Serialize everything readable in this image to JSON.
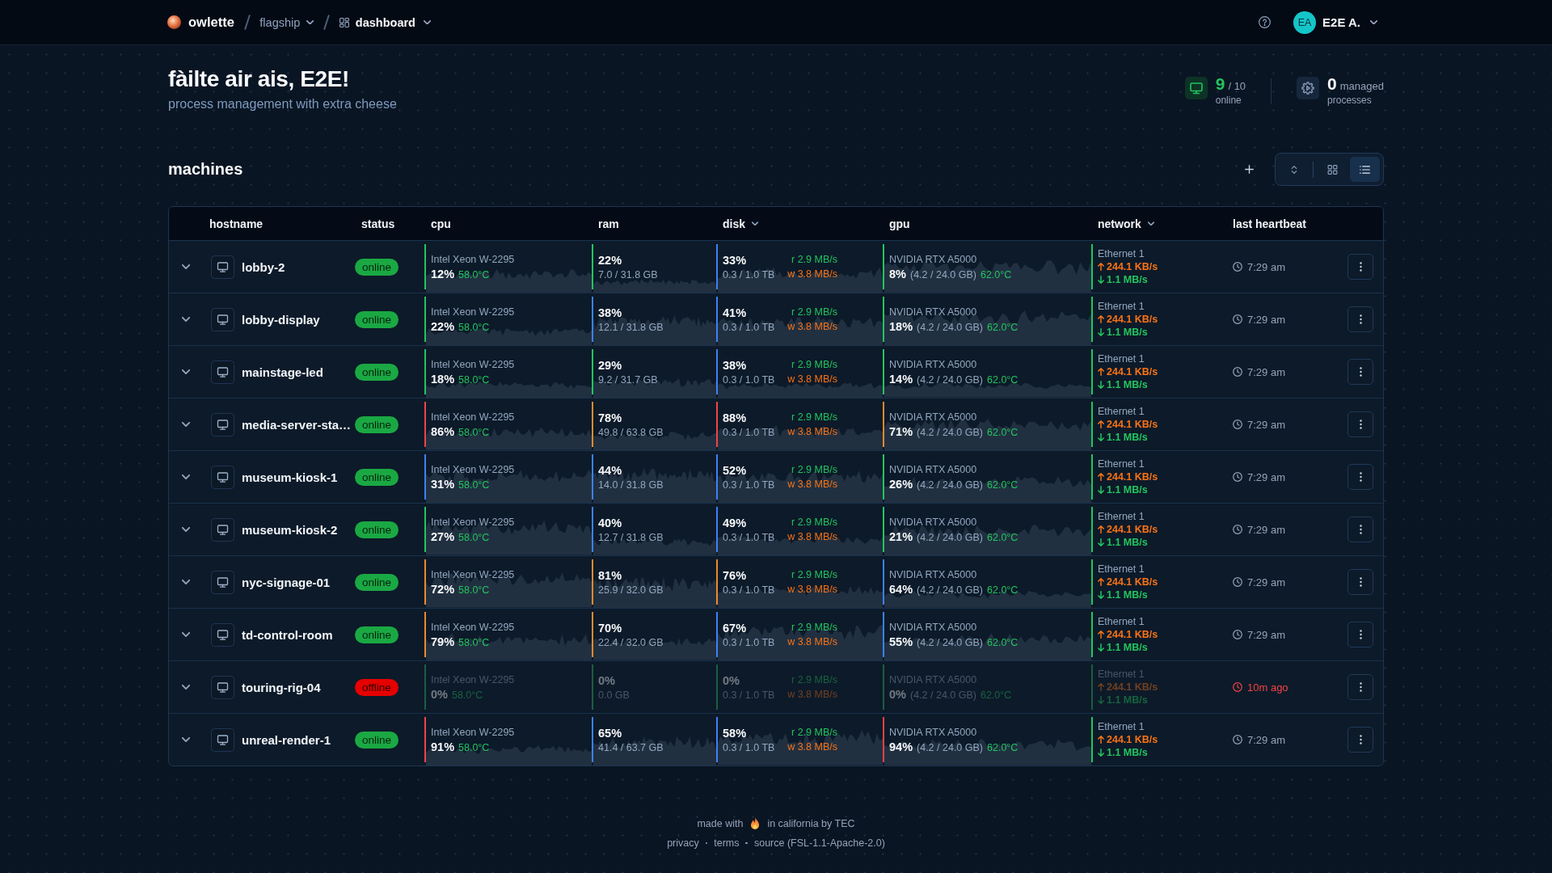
{
  "header": {
    "brand": "owlette",
    "breadcrumbs": [
      {
        "label": "flagship",
        "kind": "workspace"
      },
      {
        "label": "dashboard",
        "kind": "page"
      }
    ],
    "user": {
      "initials": "EA",
      "name": "E2E A."
    }
  },
  "greeting": {
    "title": "fàilte air ais, E2E!",
    "subtitle": "process management with extra cheese"
  },
  "stats": [
    {
      "kind": "machines",
      "value": "9",
      "detail": "/ 10",
      "label": "online"
    },
    {
      "kind": "processes",
      "value": "0",
      "detail": "managed",
      "label": "processes"
    }
  ],
  "machines": {
    "title": "machines",
    "view_options": [
      {
        "kind": "grid",
        "selected": false
      },
      {
        "kind": "list",
        "selected": true
      }
    ]
  },
  "table": {
    "columns": [
      {
        "label": "hostname",
        "sortable": false
      },
      {
        "label": "status",
        "sortable": false
      },
      {
        "label": "cpu",
        "sortable": false
      },
      {
        "label": "ram",
        "sortable": false
      },
      {
        "label": "disk",
        "sortable": true
      },
      {
        "label": "gpu",
        "sortable": false
      },
      {
        "label": "network",
        "sortable": true
      },
      {
        "label": "last heartbeat",
        "sortable": false
      }
    ],
    "rows": [
      {
        "hostname": "lobby-2",
        "status": "online",
        "online": true,
        "cpu": {
          "model": "Intel Xeon W-2295",
          "usage": "12%",
          "temp": "58.0°C",
          "color": "#22c55e"
        },
        "ram": {
          "usage": "22%",
          "detail": "7.0 / 31.8 GB",
          "color": "#22c55e"
        },
        "disk": {
          "usage": "33%",
          "detail": "0.3 / 1.0 TB",
          "read": "r 2.9 MB/s",
          "write": "w 3.8 MB/s",
          "color": "#3b82f6"
        },
        "gpu": {
          "model": "NVIDIA RTX A5000",
          "usage": "8%",
          "memory": "(4.2 / 24.0 GB)",
          "temp": "62.0°C",
          "color": "#22c55e"
        },
        "network": {
          "interface": "Ethernet 1",
          "upload": "244.1 KB/s",
          "download": "1.1 MB/s",
          "color": "#22c55e"
        },
        "last_heartbeat": "7:29 am"
      },
      {
        "hostname": "lobby-display",
        "status": "online",
        "online": true,
        "cpu": {
          "model": "Intel Xeon W-2295",
          "usage": "22%",
          "temp": "58.0°C",
          "color": "#22c55e"
        },
        "ram": {
          "usage": "38%",
          "detail": "12.1 / 31.8 GB",
          "color": "#3b82f6"
        },
        "disk": {
          "usage": "41%",
          "detail": "0.3 / 1.0 TB",
          "read": "r 2.9 MB/s",
          "write": "w 3.8 MB/s",
          "color": "#3b82f6"
        },
        "gpu": {
          "model": "NVIDIA RTX A5000",
          "usage": "18%",
          "memory": "(4.2 / 24.0 GB)",
          "temp": "62.0°C",
          "color": "#22c55e"
        },
        "network": {
          "interface": "Ethernet 1",
          "upload": "244.1 KB/s",
          "download": "1.1 MB/s",
          "color": "#22c55e"
        },
        "last_heartbeat": "7:29 am"
      },
      {
        "hostname": "mainstage-led",
        "status": "online",
        "online": true,
        "cpu": {
          "model": "Intel Xeon W-2295",
          "usage": "18%",
          "temp": "58.0°C",
          "color": "#22c55e"
        },
        "ram": {
          "usage": "29%",
          "detail": "9.2 / 31.7 GB",
          "color": "#22c55e"
        },
        "disk": {
          "usage": "38%",
          "detail": "0.3 / 1.0 TB",
          "read": "r 2.9 MB/s",
          "write": "w 3.8 MB/s",
          "color": "#3b82f6"
        },
        "gpu": {
          "model": "NVIDIA RTX A5000",
          "usage": "14%",
          "memory": "(4.2 / 24.0 GB)",
          "temp": "62.0°C",
          "color": "#22c55e"
        },
        "network": {
          "interface": "Ethernet 1",
          "upload": "244.1 KB/s",
          "download": "1.1 MB/s",
          "color": "#22c55e"
        },
        "last_heartbeat": "7:29 am"
      },
      {
        "hostname": "media-server-sta…",
        "status": "online",
        "online": true,
        "cpu": {
          "model": "Intel Xeon W-2295",
          "usage": "86%",
          "temp": "58.0°C",
          "color": "#ef4444"
        },
        "ram": {
          "usage": "78%",
          "detail": "49.8 / 63.8 GB",
          "color": "#ea8a2e"
        },
        "disk": {
          "usage": "88%",
          "detail": "0.3 / 1.0 TB",
          "read": "r 2.9 MB/s",
          "write": "w 3.8 MB/s",
          "color": "#ef4444"
        },
        "gpu": {
          "model": "NVIDIA RTX A5000",
          "usage": "71%",
          "memory": "(4.2 / 24.0 GB)",
          "temp": "62.0°C",
          "color": "#ea8a2e"
        },
        "network": {
          "interface": "Ethernet 1",
          "upload": "244.1 KB/s",
          "download": "1.1 MB/s",
          "color": "#22c55e"
        },
        "last_heartbeat": "7:29 am"
      },
      {
        "hostname": "museum-kiosk-1",
        "status": "online",
        "online": true,
        "cpu": {
          "model": "Intel Xeon W-2295",
          "usage": "31%",
          "temp": "58.0°C",
          "color": "#3b82f6"
        },
        "ram": {
          "usage": "44%",
          "detail": "14.0 / 31.8 GB",
          "color": "#3b82f6"
        },
        "disk": {
          "usage": "52%",
          "detail": "0.3 / 1.0 TB",
          "read": "r 2.9 MB/s",
          "write": "w 3.8 MB/s",
          "color": "#3b82f6"
        },
        "gpu": {
          "model": "NVIDIA RTX A5000",
          "usage": "26%",
          "memory": "(4.2 / 24.0 GB)",
          "temp": "62.0°C",
          "color": "#22c55e"
        },
        "network": {
          "interface": "Ethernet 1",
          "upload": "244.1 KB/s",
          "download": "1.1 MB/s",
          "color": "#22c55e"
        },
        "last_heartbeat": "7:29 am"
      },
      {
        "hostname": "museum-kiosk-2",
        "status": "online",
        "online": true,
        "cpu": {
          "model": "Intel Xeon W-2295",
          "usage": "27%",
          "temp": "58.0°C",
          "color": "#22c55e"
        },
        "ram": {
          "usage": "40%",
          "detail": "12.7 / 31.8 GB",
          "color": "#3b82f6"
        },
        "disk": {
          "usage": "49%",
          "detail": "0.3 / 1.0 TB",
          "read": "r 2.9 MB/s",
          "write": "w 3.8 MB/s",
          "color": "#3b82f6"
        },
        "gpu": {
          "model": "NVIDIA RTX A5000",
          "usage": "21%",
          "memory": "(4.2 / 24.0 GB)",
          "temp": "62.0°C",
          "color": "#22c55e"
        },
        "network": {
          "interface": "Ethernet 1",
          "upload": "244.1 KB/s",
          "download": "1.1 MB/s",
          "color": "#22c55e"
        },
        "last_heartbeat": "7:29 am"
      },
      {
        "hostname": "nyc-signage-01",
        "status": "online",
        "online": true,
        "cpu": {
          "model": "Intel Xeon W-2295",
          "usage": "72%",
          "temp": "58.0°C",
          "color": "#ea8a2e"
        },
        "ram": {
          "usage": "81%",
          "detail": "25.9 / 32.0 GB",
          "color": "#ea8a2e"
        },
        "disk": {
          "usage": "76%",
          "detail": "0.3 / 1.0 TB",
          "read": "r 2.9 MB/s",
          "write": "w 3.8 MB/s",
          "color": "#ea8a2e"
        },
        "gpu": {
          "model": "NVIDIA RTX A5000",
          "usage": "64%",
          "memory": "(4.2 / 24.0 GB)",
          "temp": "62.0°C",
          "color": "#3b82f6"
        },
        "network": {
          "interface": "Ethernet 1",
          "upload": "244.1 KB/s",
          "download": "1.1 MB/s",
          "color": "#22c55e"
        },
        "last_heartbeat": "7:29 am"
      },
      {
        "hostname": "td-control-room",
        "status": "online",
        "online": true,
        "cpu": {
          "model": "Intel Xeon W-2295",
          "usage": "79%",
          "temp": "58.0°C",
          "color": "#ea8a2e"
        },
        "ram": {
          "usage": "70%",
          "detail": "22.4 / 32.0 GB",
          "color": "#ea8a2e"
        },
        "disk": {
          "usage": "67%",
          "detail": "0.3 / 1.0 TB",
          "read": "r 2.9 MB/s",
          "write": "w 3.8 MB/s",
          "color": "#3b82f6"
        },
        "gpu": {
          "model": "NVIDIA RTX A5000",
          "usage": "55%",
          "memory": "(4.2 / 24.0 GB)",
          "temp": "62.0°C",
          "color": "#3b82f6"
        },
        "network": {
          "interface": "Ethernet 1",
          "upload": "244.1 KB/s",
          "download": "1.1 MB/s",
          "color": "#22c55e"
        },
        "last_heartbeat": "7:29 am"
      },
      {
        "hostname": "touring-rig-04",
        "status": "offline",
        "online": false,
        "cpu": {
          "model": "Intel Xeon W-2295",
          "usage": "0%",
          "temp": "58.0°C",
          "color": "#1b5e3f"
        },
        "ram": {
          "usage": "0%",
          "detail": "0.0 GB",
          "color": "#1b5e3f"
        },
        "disk": {
          "usage": "0%",
          "detail": "0.3 / 1.0 TB",
          "read": "r 2.9 MB/s",
          "write": "w 3.8 MB/s",
          "color": "#1b5e3f"
        },
        "gpu": {
          "model": "NVIDIA RTX A5000",
          "usage": "0%",
          "memory": "(4.2 / 24.0 GB)",
          "temp": "62.0°C",
          "color": "#1b5e3f"
        },
        "network": {
          "interface": "Ethernet 1",
          "upload": "244.1 KB/s",
          "download": "1.1 MB/s",
          "color": "#1b5e3f"
        },
        "last_heartbeat": "10m ago"
      },
      {
        "hostname": "unreal-render-1",
        "status": "online",
        "online": true,
        "cpu": {
          "model": "Intel Xeon W-2295",
          "usage": "91%",
          "temp": "58.0°C",
          "color": "#ef4444"
        },
        "ram": {
          "usage": "65%",
          "detail": "41.4 / 63.7 GB",
          "color": "#3b82f6"
        },
        "disk": {
          "usage": "58%",
          "detail": "0.3 / 1.0 TB",
          "read": "r 2.9 MB/s",
          "write": "w 3.8 MB/s",
          "color": "#3b82f6"
        },
        "gpu": {
          "model": "NVIDIA RTX A5000",
          "usage": "94%",
          "memory": "(4.2 / 24.0 GB)",
          "temp": "62.0°C",
          "color": "#ef4444"
        },
        "network": {
          "interface": "Ethernet 1",
          "upload": "244.1 KB/s",
          "download": "1.1 MB/s",
          "color": "#22c55e"
        },
        "last_heartbeat": "7:29 am"
      }
    ]
  },
  "footer": {
    "made_with": "made with",
    "credit": "in california by TEC",
    "links": [
      "privacy",
      "terms",
      "source (FSL-1.1-Apache-2.0)"
    ]
  }
}
